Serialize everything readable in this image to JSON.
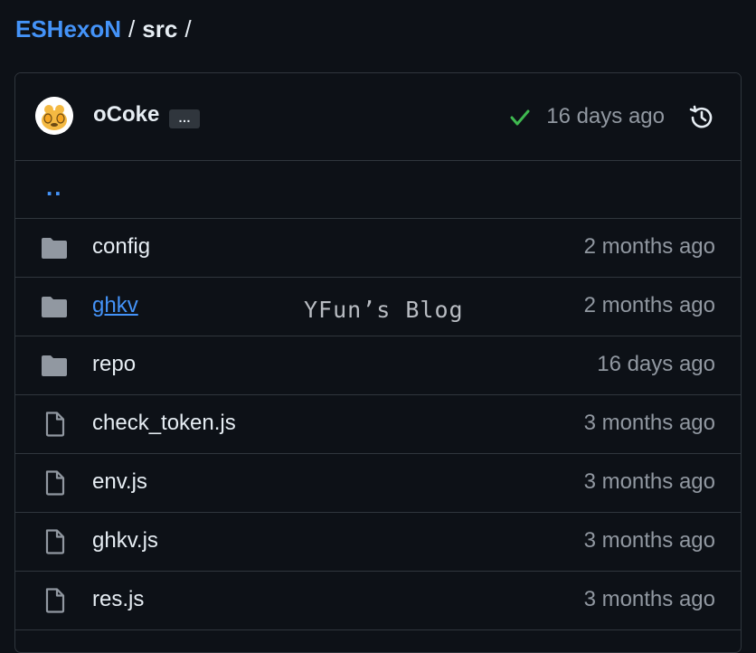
{
  "breadcrumb": {
    "repo": "ESHexoN",
    "sep1": "/",
    "dir": "src",
    "sep2": "/"
  },
  "commit": {
    "author": "oCoke",
    "ellipsis": "…",
    "status_icon": "check-icon",
    "status_color": "#3fb950",
    "time": "16 days ago",
    "history_icon": "history-icon"
  },
  "parent_link": "..",
  "files": [
    {
      "type": "folder",
      "icon": "folder-icon",
      "name": "config",
      "age": "2 months ago"
    },
    {
      "type": "folder",
      "icon": "folder-icon",
      "name": "ghkv",
      "age": "2 months ago"
    },
    {
      "type": "folder",
      "icon": "folder-icon",
      "name": "repo",
      "age": "16 days ago"
    },
    {
      "type": "file",
      "icon": "file-icon",
      "name": "check_token.js",
      "age": "3 months ago"
    },
    {
      "type": "file",
      "icon": "file-icon",
      "name": "env.js",
      "age": "3 months ago"
    },
    {
      "type": "file",
      "icon": "file-icon",
      "name": "ghkv.js",
      "age": "3 months ago"
    },
    {
      "type": "file",
      "icon": "file-icon",
      "name": "res.js",
      "age": "3 months ago"
    }
  ],
  "watermark": "YFun’s Blog",
  "colors": {
    "background": "#0d1117",
    "border": "#30363d",
    "link": "#4493f8",
    "muted": "#9198a1"
  }
}
